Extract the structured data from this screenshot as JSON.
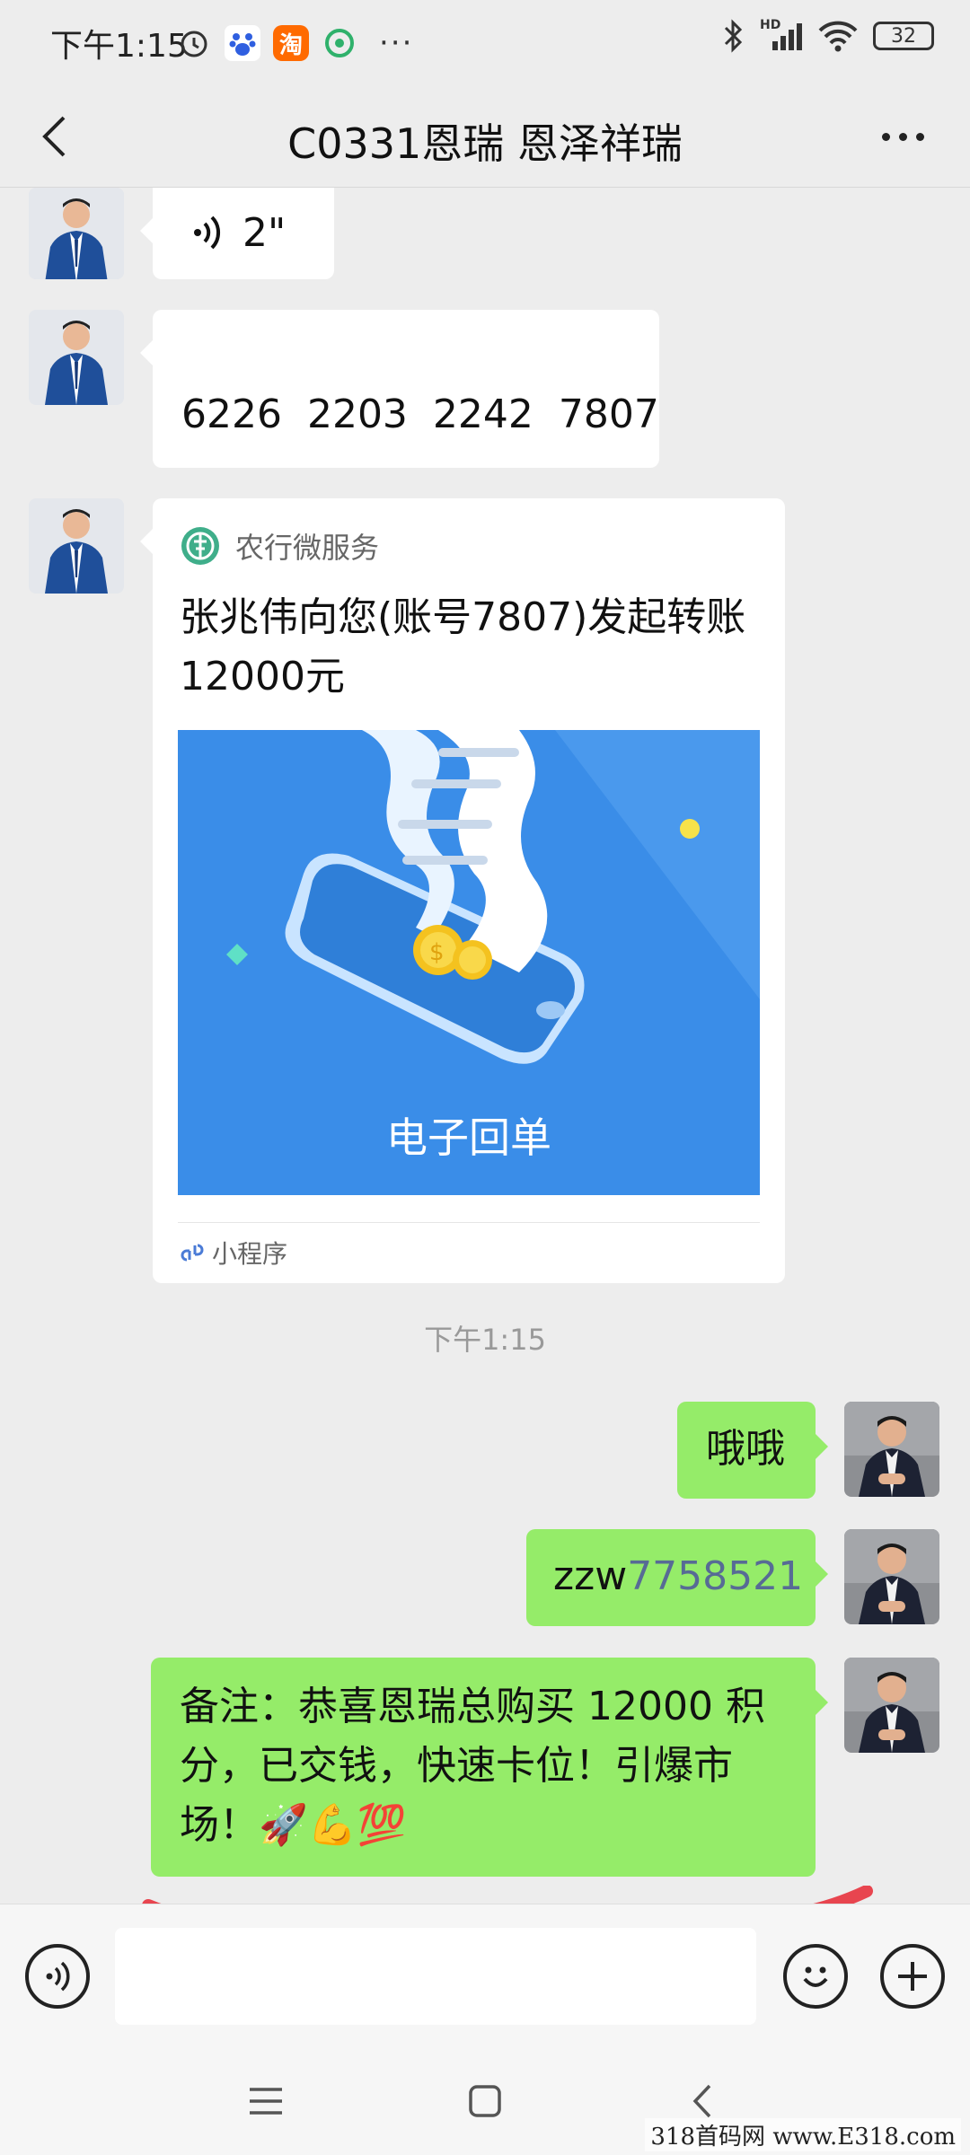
{
  "status_bar": {
    "time": "下午1:15",
    "left_icons": [
      "alarm-icon",
      "baidu-icon",
      "taobao-icon",
      "app-icon"
    ],
    "taobao_label": "淘",
    "battery": "32",
    "network_label": "HD"
  },
  "header": {
    "title": "C0331恩瑞  恩泽祥瑞"
  },
  "messages": {
    "voice": {
      "duration": "2\""
    },
    "card_number": "6226  2203  2242  7807",
    "mini_program": {
      "source": "农行微服务",
      "title": "张兆伟向您(账号7807)发起转账12000元",
      "image_caption": "电子回单",
      "footer": "小程序"
    },
    "timestamp": "下午1:15",
    "me_1": "哦哦",
    "me_2_prefix": "zzw",
    "me_2_link": "7758521",
    "me_3": "备注：恭喜恩瑞总购买  12000 积分，已交钱，快速卡位！引爆市场！🚀💪💯"
  },
  "watermark": "318首码网 www.E318.com",
  "colors": {
    "bubble_me": "#95ec69",
    "link": "#576b95",
    "red_underline": "#e8454f",
    "card_blue": "#3b8ee8"
  }
}
